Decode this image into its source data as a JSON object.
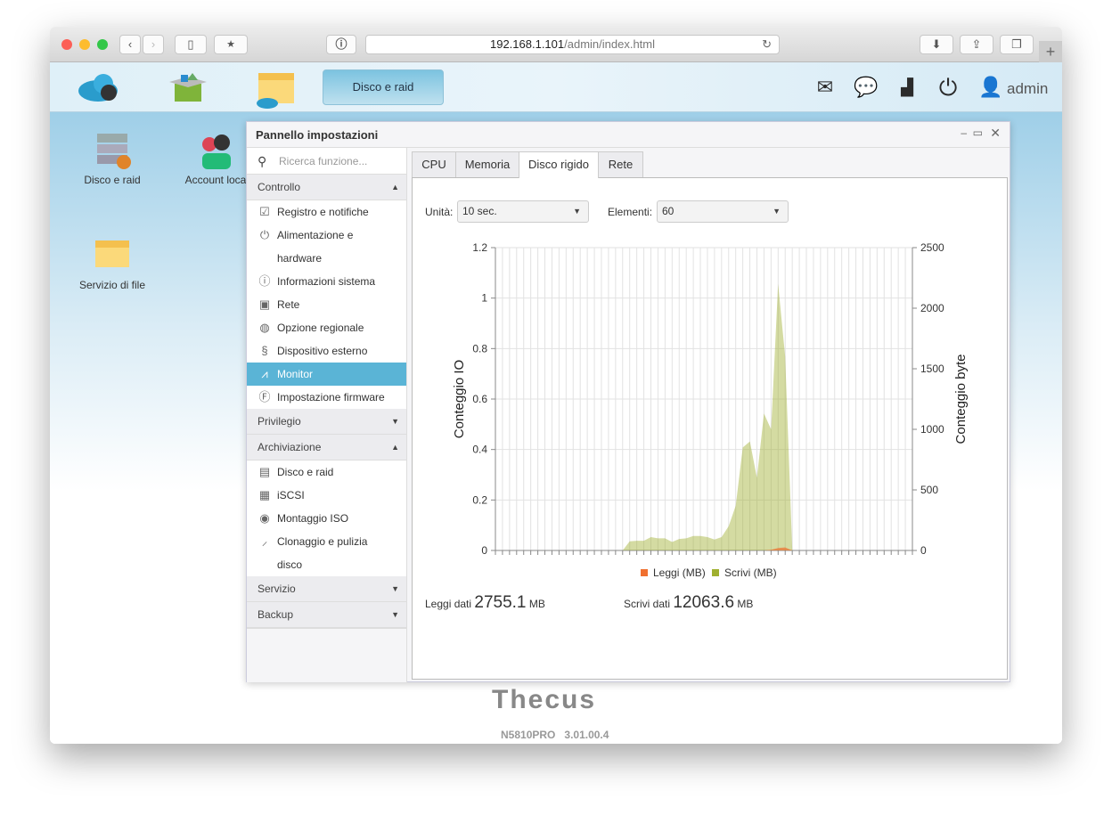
{
  "browser": {
    "url_host": "192.168.1.101",
    "url_path": "/admin/index.html"
  },
  "appbar": {
    "active_tab": "Disco e raid",
    "user": "admin"
  },
  "desktop": {
    "icons": [
      {
        "label": "Disco e raid"
      },
      {
        "label": "Account loca"
      },
      {
        "label": "Servizio di file"
      }
    ],
    "brand": "Thecus",
    "model": "N5810PRO",
    "version": "3.01.00.4"
  },
  "panel": {
    "title": "Pannello impostazioni",
    "search_placeholder": "Ricerca funzione...",
    "sections": [
      {
        "label": "Controllo",
        "expanded": true,
        "items": [
          {
            "label": "Registro e notifiche",
            "icon": "clipboard-check-icon"
          },
          {
            "label": "Alimentazione e",
            "label2": "hardware",
            "icon": "power-icon"
          },
          {
            "label": "Informazioni sistema",
            "icon": "info-icon"
          },
          {
            "label": "Rete",
            "icon": "network-icon"
          },
          {
            "label": "Opzione regionale",
            "icon": "globe-icon"
          },
          {
            "label": "Dispositivo esterno",
            "icon": "usb-icon"
          },
          {
            "label": "Monitor",
            "icon": "chart-icon",
            "selected": true
          },
          {
            "label": "Impostazione firmware",
            "icon": "firmware-icon"
          }
        ]
      },
      {
        "label": "Privilegio",
        "expanded": false
      },
      {
        "label": "Archiviazione",
        "expanded": true,
        "items": [
          {
            "label": "Disco e raid",
            "icon": "disk-icon"
          },
          {
            "label": "iSCSI",
            "icon": "iscsi-icon"
          },
          {
            "label": "Montaggio ISO",
            "icon": "iso-icon"
          },
          {
            "label": "Clonaggio e pulizia",
            "label2": "disco",
            "icon": "broom-icon"
          }
        ]
      },
      {
        "label": "Servizio",
        "expanded": false
      },
      {
        "label": "Backup",
        "expanded": false
      }
    ]
  },
  "monitor": {
    "tabs": [
      "CPU",
      "Memoria",
      "Disco rigido",
      "Rete"
    ],
    "active_tab": "Disco rigido",
    "unit_label": "Unità:",
    "unit_value": "10 sec.",
    "elements_label": "Elementi:",
    "elements_value": "60",
    "read_label": "Leggi dati",
    "read_value": "2755.1",
    "read_unit": "MB",
    "write_label": "Scrivi dati",
    "write_value": "12063.6",
    "write_unit": "MB"
  },
  "chart_data": {
    "type": "area",
    "points": 60,
    "ylabel_left": "Conteggio IO",
    "ylabel_right": "Conteggio byte",
    "yleft_ticks": [
      "0",
      "0.2",
      "0.4",
      "0.6",
      "0.8",
      "1",
      "1.2"
    ],
    "yleft_range": [
      0,
      1.2
    ],
    "yright_ticks": [
      "0",
      "500",
      "1000",
      "1500",
      "2000",
      "2500"
    ],
    "yright_range": [
      0,
      2500
    ],
    "legend_position": "bottom",
    "grid": true,
    "series": [
      {
        "name": "Leggi (MB)",
        "color": "#f07030",
        "values": [
          0,
          0,
          0,
          0,
          0,
          0,
          0,
          0,
          0,
          0,
          0,
          0,
          0,
          0,
          0,
          0,
          0,
          0,
          0,
          0,
          0,
          0,
          0,
          0,
          0,
          0,
          0,
          0,
          0,
          0,
          0,
          0,
          0,
          0,
          0,
          0,
          0,
          0,
          0,
          5,
          20,
          25,
          0,
          0,
          0,
          0,
          0,
          0,
          0,
          0,
          0,
          0,
          0,
          0,
          0,
          0,
          0,
          0,
          0,
          0
        ]
      },
      {
        "name": "Scrivi (MB)",
        "color": "#a0b030",
        "values": [
          0,
          0,
          0,
          0,
          0,
          0,
          0,
          0,
          0,
          0,
          0,
          0,
          0,
          0,
          0,
          0,
          0,
          0,
          0,
          75,
          80,
          80,
          110,
          100,
          100,
          70,
          95,
          100,
          120,
          120,
          110,
          90,
          110,
          200,
          370,
          850,
          900,
          600,
          1130,
          1000,
          2200,
          1600,
          0,
          0,
          0,
          0,
          0,
          0,
          0,
          0,
          0,
          0,
          0,
          0,
          0,
          0,
          0,
          0,
          0,
          0
        ]
      }
    ]
  }
}
